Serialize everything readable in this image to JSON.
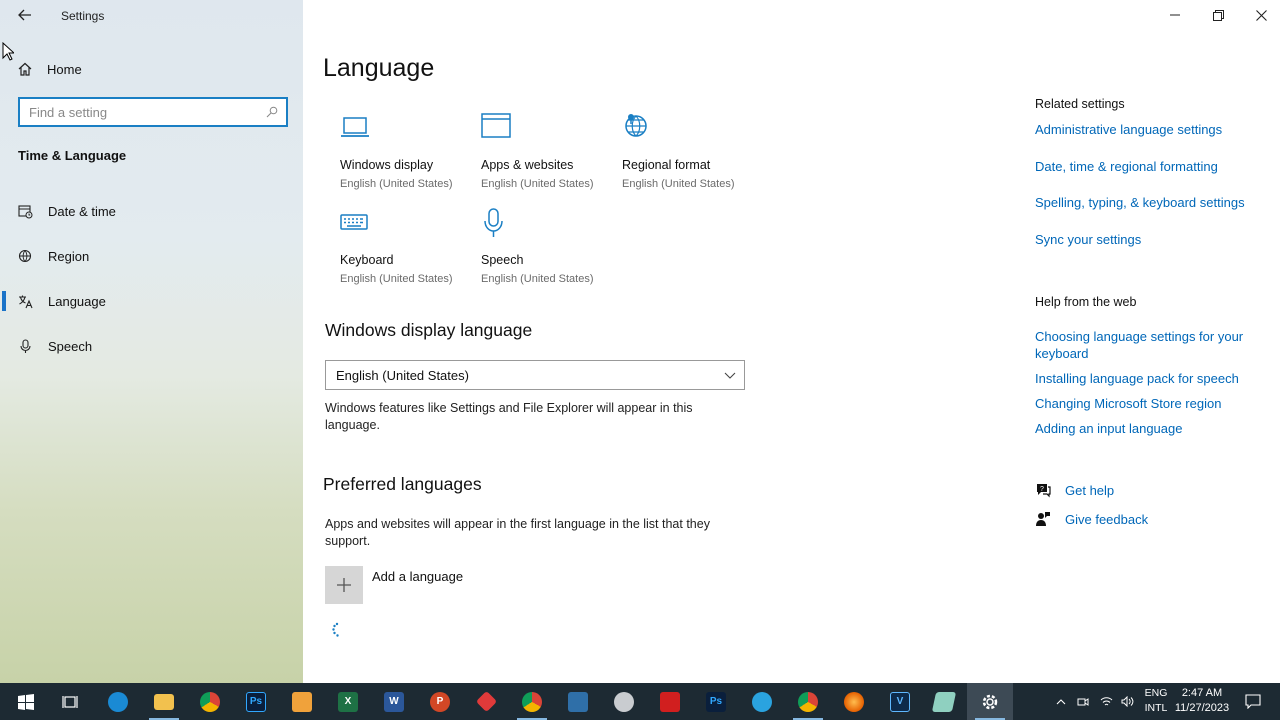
{
  "window": {
    "title": "Settings"
  },
  "sidebar": {
    "home_label": "Home",
    "search_placeholder": "Find a setting",
    "section": "Time & Language",
    "items": [
      {
        "label": "Date & time",
        "icon": "calendar-clock-icon"
      },
      {
        "label": "Region",
        "icon": "globe-region-icon"
      },
      {
        "label": "Language",
        "icon": "language-icon",
        "active": true
      },
      {
        "label": "Speech",
        "icon": "microphone-icon"
      }
    ]
  },
  "main": {
    "title": "Language",
    "tiles": [
      {
        "label": "Windows display",
        "sub": "English (United States)",
        "icon": "laptop-icon"
      },
      {
        "label": "Apps & websites",
        "sub": "English (United States)",
        "icon": "browser-window-icon"
      },
      {
        "label": "Regional format",
        "sub": "English (United States)",
        "icon": "globe-pin-icon"
      },
      {
        "label": "Keyboard",
        "sub": "English (United States)",
        "icon": "keyboard-icon"
      },
      {
        "label": "Speech",
        "sub": "English (United States)",
        "icon": "microphone-icon"
      }
    ],
    "display_language": {
      "heading": "Windows display language",
      "selected": "English (United States)",
      "description": "Windows features like Settings and File Explorer will appear in this language."
    },
    "preferred": {
      "heading": "Preferred languages",
      "description": "Apps and websites will appear in the first language in the list that they support.",
      "add_label": "Add a language"
    }
  },
  "related": {
    "heading": "Related settings",
    "links": [
      "Administrative language settings",
      "Date, time & regional formatting",
      "Spelling, typing, & keyboard settings",
      "Sync your settings"
    ]
  },
  "help": {
    "heading": "Help from the web",
    "links": [
      "Choosing language settings for your keyboard",
      "Installing language pack for speech",
      "Changing Microsoft Store region",
      "Adding an input language"
    ],
    "get_help": "Get help",
    "give_feedback": "Give feedback"
  },
  "taskbar": {
    "apps": [
      "start-icon",
      "task-view-icon",
      "edge-icon",
      "file-explorer-icon",
      "chrome-icon",
      "photoshop-icon",
      "office-icon",
      "excel-icon",
      "word-icon",
      "powerpoint-icon",
      "anydesk-icon",
      "chrome-profile-icon",
      "python-installer-icon",
      "paint-icon",
      "acrobat-icon",
      "photoshop-icon-2",
      "telegram-icon",
      "chrome-profile-icon-2",
      "firefox-icon",
      "vegas-icon",
      "notes-icon",
      "settings-icon"
    ],
    "lang_top": "ENG",
    "lang_bottom": "INTL",
    "time": "2:47 AM",
    "date": "11/27/2023"
  },
  "colors": {
    "accent": "#0067b8",
    "icon_blue": "#1a7fc4",
    "taskbar": "#1d2a33"
  }
}
